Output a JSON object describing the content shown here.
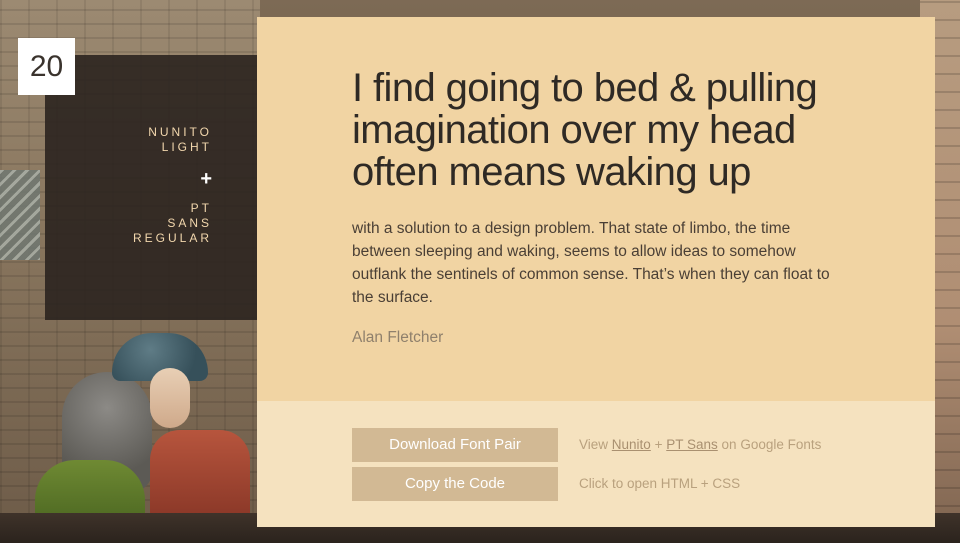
{
  "slide": {
    "number": "20"
  },
  "font_pair": {
    "heading_font": [
      "NUNITO",
      "LIGHT"
    ],
    "plus": "+",
    "body_font": [
      "PT",
      "SANS",
      "REGULAR"
    ]
  },
  "quote": {
    "headline": "I find going to bed & pulling imagination over my head often means waking up",
    "body": "with a solution to a design problem. That state of limbo, the time between sleeping and waking, seems to allow ideas to somehow outflank the sentinels of common sense. That’s when they can float to the surface.",
    "author": "Alan Fletcher"
  },
  "actions": {
    "download_label": "Download Font Pair",
    "copy_label": "Copy the Code",
    "view_prefix": "View",
    "font1_link": "Nunito",
    "plus_text": "+",
    "font2_link": "PT Sans",
    "view_suffix": "on Google Fonts",
    "open_hint": "Click to open HTML + CSS"
  },
  "colors": {
    "card_background": "#f1d4a3",
    "footer_background": "#f5e2bf",
    "button_background": "#d2b994",
    "panel_background": "#2b231f",
    "headline_color": "#2f2a25"
  },
  "icons": {
    "plus": "plus-icon"
  }
}
